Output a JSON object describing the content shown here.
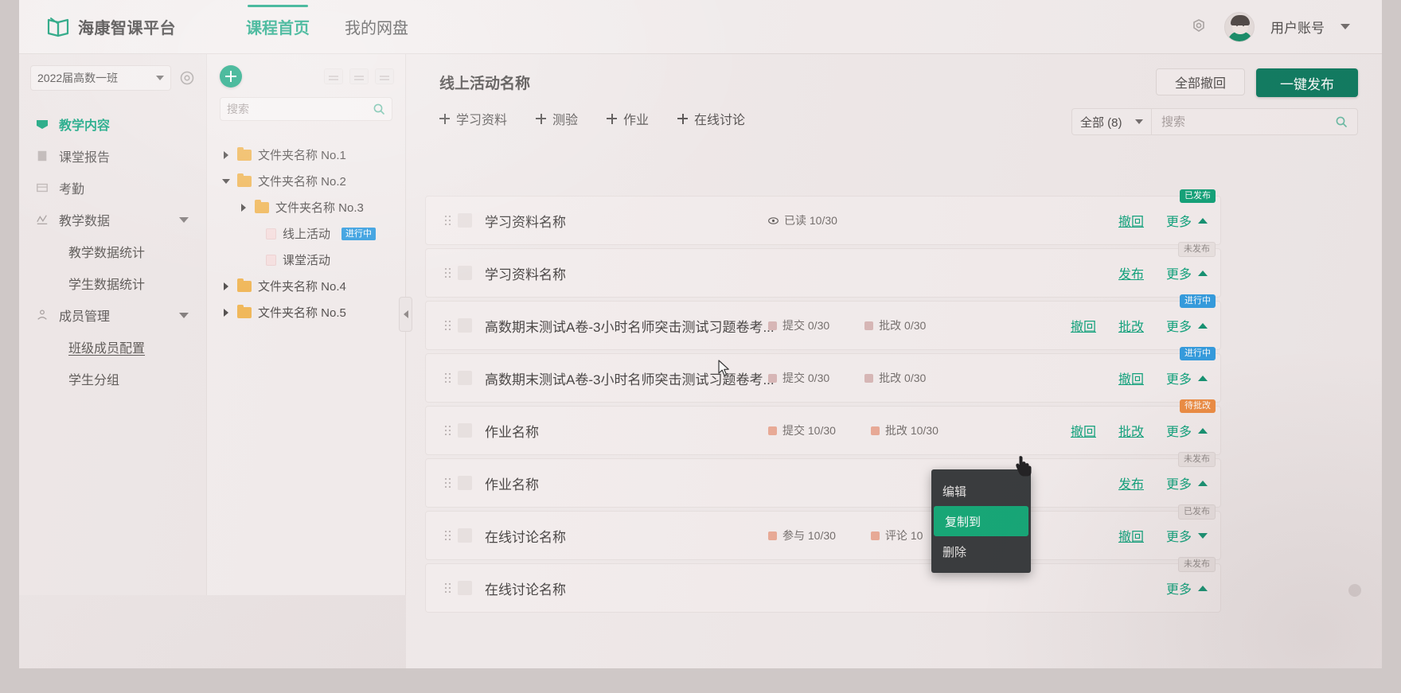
{
  "header": {
    "logo_text": "海康智课平台",
    "nav": [
      {
        "label": "课程首页",
        "active": true
      },
      {
        "label": "我的网盘",
        "active": false
      }
    ],
    "user_name": "用户账号",
    "settings_icon": "gear-icon",
    "caret_icon": "chevron-down-icon"
  },
  "sidebar": {
    "class_selector": "2022届高数一班",
    "settings_icon": "gear-icon",
    "items": [
      {
        "label": "教学内容",
        "icon": "book-icon",
        "active": true,
        "expandable": false
      },
      {
        "label": "课堂报告",
        "icon": "report-icon",
        "active": false,
        "expandable": false
      },
      {
        "label": "考勤",
        "icon": "attendance-icon",
        "active": false,
        "expandable": false
      },
      {
        "label": "教学数据",
        "icon": "chart-icon",
        "active": false,
        "expandable": true
      },
      {
        "label": "教学数据统计",
        "sub": true
      },
      {
        "label": "学生数据统计",
        "sub": true
      },
      {
        "label": "成员管理",
        "icon": "people-icon",
        "active": false,
        "expandable": true
      },
      {
        "label": "班级成员配置",
        "sub": true,
        "underlined": true
      },
      {
        "label": "学生分组",
        "sub": true
      }
    ]
  },
  "tree": {
    "add_button_icon": "plus-icon",
    "tool_icons": [
      "grid-icon",
      "list-icon",
      "sort-icon"
    ],
    "search_placeholder": "搜索",
    "search_value": "",
    "search_icon": "search-icon",
    "nodes": [
      {
        "label": "文件夹名称 No.1",
        "type": "folder",
        "depth": 0,
        "expanded": false
      },
      {
        "label": "文件夹名称 No.2",
        "type": "folder",
        "depth": 0,
        "expanded": true
      },
      {
        "label": "文件夹名称  No.3",
        "type": "folder",
        "depth": 1,
        "expanded": false
      },
      {
        "label": "线上活动",
        "type": "doc",
        "depth": 2,
        "badge": "进行中"
      },
      {
        "label": "课堂活动",
        "type": "doc",
        "depth": 2
      },
      {
        "label": "文件夹名称 No.4",
        "type": "folder",
        "depth": 0,
        "expanded": false
      },
      {
        "label": "文件夹名称 No.5",
        "type": "folder",
        "depth": 0,
        "expanded": false
      }
    ],
    "collapse_handle_icon": "chevron-left-icon"
  },
  "main": {
    "title": "线上活动名称",
    "toolbar": [
      {
        "label": "学习资料"
      },
      {
        "label": "测验"
      },
      {
        "label": "作业"
      },
      {
        "label": "在线讨论"
      }
    ],
    "withdraw_all_label": "全部撤回",
    "publish_all_label": "一键发布",
    "filter_label": "全部 (8)",
    "search_placeholder": "搜索",
    "search_value": "",
    "rows": [
      {
        "title": "学习资料名称",
        "stats": [
          {
            "icon": "eye-icon",
            "label": "已读 10/30",
            "color": "#6e6967"
          }
        ],
        "actions": [
          "撤回"
        ],
        "more_label": "更多",
        "more_state": "up",
        "badge": {
          "text": "已发布",
          "style": "green"
        }
      },
      {
        "title": "学习资料名称",
        "stats": [],
        "actions": [
          "发布"
        ],
        "more_label": "更多",
        "more_state": "up",
        "badge": {
          "text": "未发布",
          "style": "grey"
        }
      },
      {
        "title": "高数期末测试A卷-3小时名师突击测试习题卷考...",
        "stats": [
          {
            "icon": "submit-icon",
            "label": "提交 0/30",
            "color": "#c8a7a6"
          },
          {
            "icon": "grade-icon",
            "label": "批改 0/30",
            "color": "#c8a7a6"
          }
        ],
        "actions": [
          "撤回",
          "批改"
        ],
        "more_label": "更多",
        "more_state": "up",
        "badge": {
          "text": "进行中",
          "style": "blue"
        }
      },
      {
        "title": "高数期末测试A卷-3小时名师突击测试习题卷考...",
        "stats": [
          {
            "icon": "submit-icon",
            "label": "提交 0/30",
            "color": "#c8a7a6"
          },
          {
            "icon": "grade-icon",
            "label": "批改 0/30",
            "color": "#c8a7a6"
          }
        ],
        "actions": [
          "撤回"
        ],
        "more_label": "更多",
        "more_state": "up",
        "badge": {
          "text": "进行中",
          "style": "blue"
        }
      },
      {
        "title": "作业名称",
        "stats": [
          {
            "icon": "submit-icon",
            "label": "提交 10/30",
            "color": "#e0a090"
          },
          {
            "icon": "grade-icon",
            "label": "批改 10/30",
            "color": "#e0a090"
          }
        ],
        "actions": [
          "撤回",
          "批改"
        ],
        "more_label": "更多",
        "more_state": "up",
        "badge": {
          "text": "待批改",
          "style": "orange"
        }
      },
      {
        "title": "作业名称",
        "stats": [],
        "actions": [
          "发布"
        ],
        "more_label": "更多",
        "more_state": "up",
        "badge": {
          "text": "未发布",
          "style": "grey"
        }
      },
      {
        "title": "在线讨论名称",
        "stats": [
          {
            "icon": "participate-icon",
            "label": "参与 10/30",
            "color": "#e0a090"
          },
          {
            "icon": "comment-icon",
            "label": "评论 10",
            "color": "#e0a090"
          }
        ],
        "actions": [
          "撤回"
        ],
        "more_label": "更多",
        "more_state": "down",
        "badge": {
          "text": "已发布",
          "style": "grey"
        }
      },
      {
        "title": "在线讨论名称",
        "stats": [],
        "actions": [],
        "more_label": "更多",
        "more_state": "up",
        "badge": {
          "text": "未发布",
          "style": "grey"
        }
      }
    ]
  },
  "context_menu": {
    "items": [
      {
        "label": "编辑",
        "highlighted": false
      },
      {
        "label": "复制到",
        "highlighted": true
      },
      {
        "label": "删除",
        "highlighted": false
      }
    ]
  },
  "colors": {
    "brand_green": "#07a179",
    "primary_button": "#06785c",
    "badge_blue": "#2b9ae0",
    "badge_orange": "#ef8a3c",
    "folder_orange": "#f0b450"
  }
}
